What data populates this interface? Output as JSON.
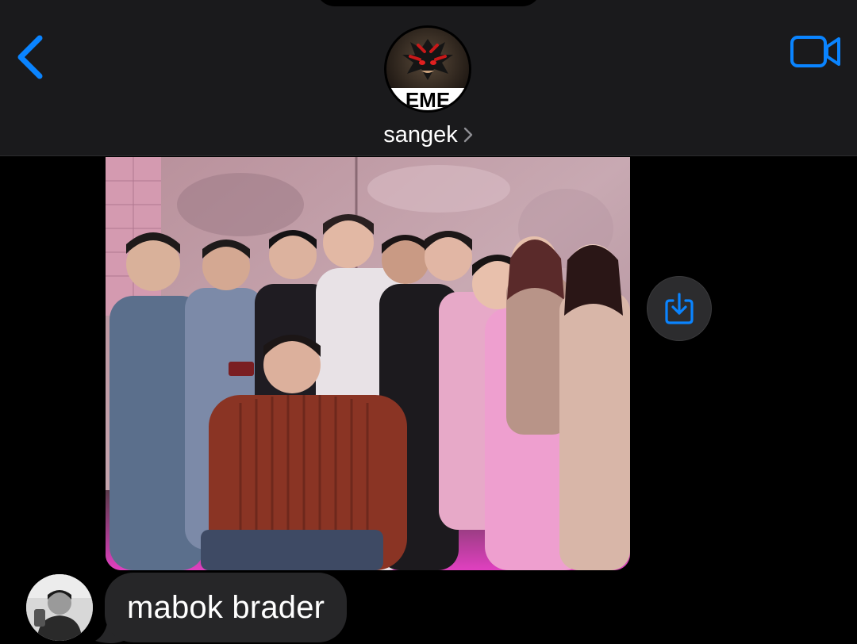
{
  "header": {
    "contact_name": "sangek",
    "avatar_banner_text": "EME",
    "back_icon": "chevron-left-icon",
    "video_icon": "video-camera-icon",
    "name_chevron_icon": "chevron-right-icon"
  },
  "messages": [
    {
      "type": "photo",
      "direction": "incoming",
      "description_icon": "group-photo",
      "save_icon": "save-download-icon"
    },
    {
      "type": "text",
      "direction": "incoming",
      "text": "mabok brader"
    }
  ],
  "colors": {
    "accent": "#0a84ff",
    "header_bg": "#1a1a1c",
    "bubble_bg": "#262628",
    "background": "#000000"
  }
}
